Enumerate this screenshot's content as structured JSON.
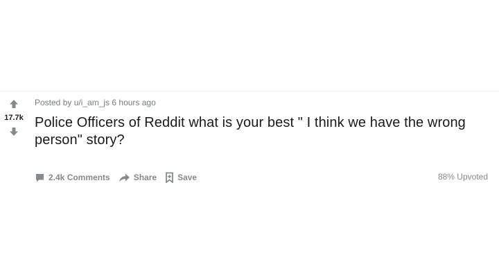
{
  "post": {
    "score": "17.7k",
    "meta_prefix": "Posted by ",
    "author": "u/i_am_js",
    "age": " 6 hours ago",
    "title": "Police Officers of Reddit what is your best \" I think we have the wrong person\" story?",
    "upvote_icon": "arrow-up-icon",
    "downvote_icon": "arrow-down-icon"
  },
  "actions": {
    "comments_label": "2.4k Comments",
    "share_label": "Share",
    "save_label": "Save",
    "upvoted_text": "88% Upvoted"
  },
  "colors": {
    "text_primary": "#1a1a1b",
    "text_meta": "#787c7e",
    "icon_gray": "#878a8c"
  }
}
